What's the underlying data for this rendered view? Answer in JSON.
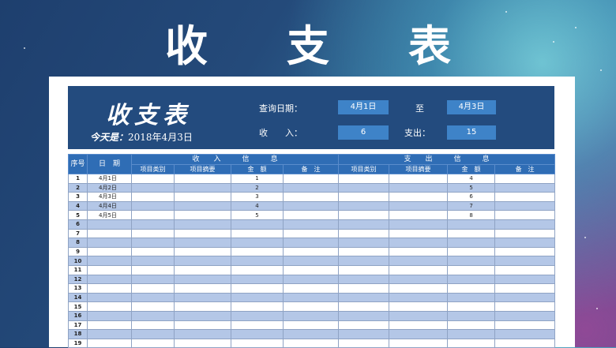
{
  "title_chars": [
    "收",
    "支",
    "表"
  ],
  "panel": {
    "logo": "收支表",
    "today_label": "今天是：",
    "today_date": "2018年4月3日",
    "query_label": "查询日期：",
    "query_from": "4月1日",
    "to_label": "至",
    "query_to": "4月3日",
    "income_label": "收　　入：",
    "income_value": "6",
    "expense_label": "支出：",
    "expense_value": "15"
  },
  "table": {
    "header1": {
      "seq": "序号",
      "date": "日　期",
      "income_a": "收",
      "income_b": "入",
      "income_c": "信",
      "income_d": "息",
      "expense_a": "支",
      "expense_b": "出",
      "expense_c": "信",
      "expense_d": "息"
    },
    "header2": {
      "inc_category": "项目类别",
      "inc_summary": "项目摘要",
      "inc_amount": "金　额",
      "inc_note": "备　注",
      "exp_category": "项目类别",
      "exp_summary": "项目摘要",
      "exp_amount": "金　额",
      "exp_note": "备　注"
    },
    "rows": [
      {
        "seq": "1",
        "date": "4月1日",
        "inc_amount": "1",
        "exp_amount": "4"
      },
      {
        "seq": "2",
        "date": "4月2日",
        "inc_amount": "2",
        "exp_amount": "5"
      },
      {
        "seq": "3",
        "date": "4月3日",
        "inc_amount": "3",
        "exp_amount": "6"
      },
      {
        "seq": "4",
        "date": "4月4日",
        "inc_amount": "4",
        "exp_amount": "7"
      },
      {
        "seq": "5",
        "date": "4月5日",
        "inc_amount": "5",
        "exp_amount": "8"
      },
      {
        "seq": "6",
        "date": "",
        "inc_amount": "",
        "exp_amount": ""
      },
      {
        "seq": "7",
        "date": "",
        "inc_amount": "",
        "exp_amount": ""
      },
      {
        "seq": "8",
        "date": "",
        "inc_amount": "",
        "exp_amount": ""
      },
      {
        "seq": "9",
        "date": "",
        "inc_amount": "",
        "exp_amount": ""
      },
      {
        "seq": "10",
        "date": "",
        "inc_amount": "",
        "exp_amount": ""
      },
      {
        "seq": "11",
        "date": "",
        "inc_amount": "",
        "exp_amount": ""
      },
      {
        "seq": "12",
        "date": "",
        "inc_amount": "",
        "exp_amount": ""
      },
      {
        "seq": "13",
        "date": "",
        "inc_amount": "",
        "exp_amount": ""
      },
      {
        "seq": "14",
        "date": "",
        "inc_amount": "",
        "exp_amount": ""
      },
      {
        "seq": "15",
        "date": "",
        "inc_amount": "",
        "exp_amount": ""
      },
      {
        "seq": "16",
        "date": "",
        "inc_amount": "",
        "exp_amount": ""
      },
      {
        "seq": "17",
        "date": "",
        "inc_amount": "",
        "exp_amount": ""
      },
      {
        "seq": "18",
        "date": "",
        "inc_amount": "",
        "exp_amount": ""
      },
      {
        "seq": "19",
        "date": "",
        "inc_amount": "",
        "exp_amount": ""
      }
    ]
  }
}
